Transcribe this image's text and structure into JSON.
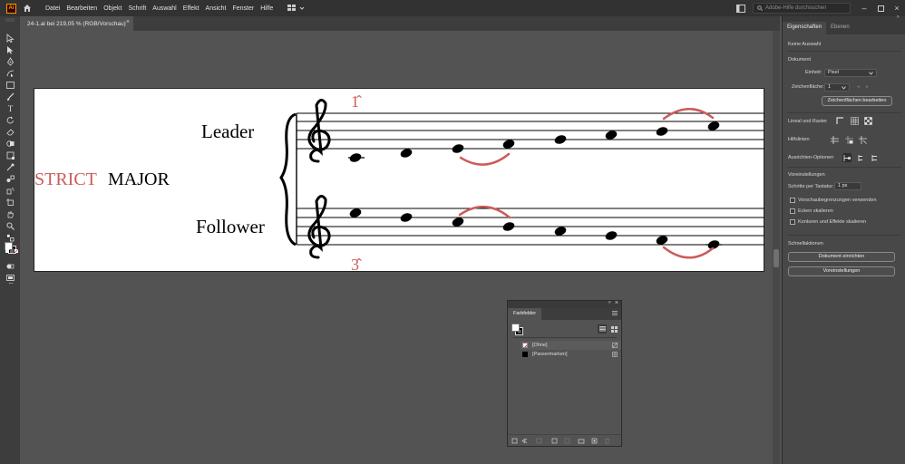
{
  "menubar": {
    "app_logo": "Ai",
    "items": [
      "Datei",
      "Bearbeiten",
      "Objekt",
      "Schrift",
      "Auswahl",
      "Effekt",
      "Ansicht",
      "Fenster",
      "Hilfe"
    ],
    "search_placeholder": "Adobe-Hilfe durchsuchen"
  },
  "document_tab": {
    "title": "24-1.ai bei 219,05 % (RGB/Vorschau)",
    "close": "×"
  },
  "artboard": {
    "title_strict": "STRICT",
    "title_major": "MAJOR",
    "leader_label": "Leader",
    "follower_label": "Follower",
    "leader_degree": "1̂",
    "follower_degree": "3̂",
    "accent_color": "#cc5b5b"
  },
  "properties_panel": {
    "tabs": [
      "Eigenschaften",
      "Ebenen"
    ],
    "no_selection": "Keine Auswahl",
    "document_section": "Dokument",
    "unit_label": "Einheit:",
    "unit_value": "Pixel",
    "artboard_label": "Zeichenfläche:",
    "artboard_value": "1",
    "edit_artboards_button": "Zeichenflächen bearbeiten",
    "rulers_grids": "Lineal und Raster",
    "guides": "Hilfslinien",
    "snap_options": "Ausrichten-Optionen",
    "preferences_section": "Voreinstellungen",
    "keyboard_increment_label": "Schritte per Tastatur:",
    "keyboard_increment_value": "1 px",
    "check_preview_bounds": "Vorschaubegrenzungen verwenden",
    "check_scale_corners": "Ecken skalieren",
    "check_scale_strokes": "Konturen und Effekte skalieren",
    "quick_actions": "Schnellaktionen",
    "setup_document_button": "Dokument einrichten",
    "preferences_button": "Voreinstellungen"
  },
  "swatches_panel": {
    "tab": "Farbfelder",
    "swatches": [
      {
        "label": "[Ohne]",
        "color": "#ffffff"
      },
      {
        "label": "[Passermarken]",
        "color": "#000000"
      }
    ]
  }
}
